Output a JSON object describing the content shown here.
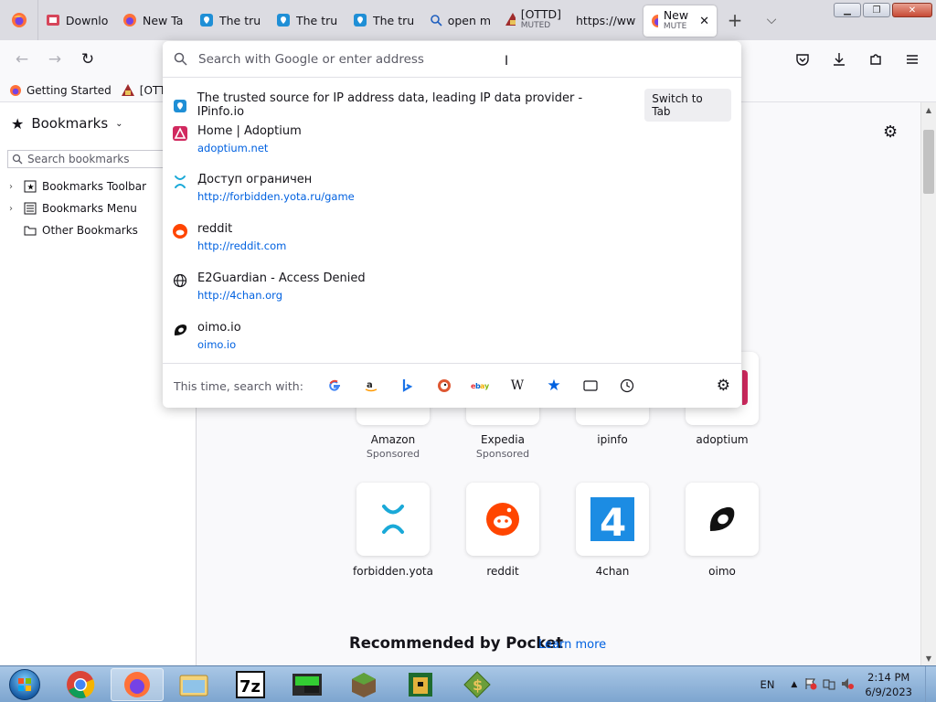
{
  "colors": {
    "accent": "#0061e0",
    "firefox_orange": "#ff7139",
    "ipinfo_blue": "#1f8fd6",
    "adoptium_pink": "#d1295f",
    "reddit_orange": "#ff4500",
    "taskbar": "#8fb3da"
  },
  "tabs": [
    {
      "title": "Downlo",
      "icon": "download-page-icon"
    },
    {
      "title": "New Ta",
      "icon": "firefox-icon"
    },
    {
      "title": "The tru",
      "icon": "ipinfo-icon"
    },
    {
      "title": "The tru",
      "icon": "ipinfo-icon"
    },
    {
      "title": "The tru",
      "icon": "ipinfo-icon"
    },
    {
      "title": "open m",
      "icon": "search-icon"
    },
    {
      "title": "[OTTD]",
      "subtitle": "MUTED",
      "icon": "ottd-icon"
    },
    {
      "title": "https://www",
      "icon": ""
    },
    {
      "title": "New",
      "subtitle": "MUTE",
      "icon": "firefox-icon",
      "active": true
    }
  ],
  "bookmarks_toolbar": [
    {
      "label": "Getting Started",
      "icon": "firefox-icon"
    },
    {
      "label": "[OTTD",
      "icon": "ottd-icon"
    }
  ],
  "sidebar": {
    "title": "Bookmarks",
    "search_placeholder": "Search bookmarks",
    "nodes": [
      {
        "label": "Bookmarks Toolbar",
        "expandable": true,
        "icon": "bookmark-toolbar-icon"
      },
      {
        "label": "Bookmarks Menu",
        "expandable": true,
        "icon": "bookmark-menu-icon"
      },
      {
        "label": "Other Bookmarks",
        "expandable": false,
        "icon": "folder-icon"
      }
    ]
  },
  "urlbar": {
    "placeholder": "Search with Google or enter address",
    "results": [
      {
        "title": "The trusted source for IP address data, leading IP data provider - IPinfo.io",
        "action": "Switch to Tab",
        "icon": "ipinfo-icon"
      },
      {
        "title": "Home | Adoptium",
        "url": "adoptium.net",
        "icon": "adoptium-icon"
      },
      {
        "title": "Доступ ограничен",
        "url": "http://forbidden.yota.ru/game",
        "icon": "yota-icon"
      },
      {
        "title": "reddit",
        "url": "http://reddit.com",
        "icon": "reddit-icon"
      },
      {
        "title": "E2Guardian - Access Denied",
        "url": "http://4chan.org",
        "icon": "globe-icon"
      },
      {
        "title": "oimo.io",
        "url": "oimo.io",
        "icon": "oimo-icon"
      }
    ],
    "one_off_label": "This time, search with:",
    "engines": [
      "google-icon",
      "amazon-icon",
      "bing-icon",
      "duckduckgo-icon",
      "ebay-icon",
      "wikipedia-icon",
      "bookmarks-star-icon",
      "tabs-icon",
      "history-icon"
    ]
  },
  "top_sites": [
    {
      "label": "Amazon",
      "sub": "Sponsored",
      "row": 1
    },
    {
      "label": "Expedia",
      "sub": "Sponsored",
      "row": 1
    },
    {
      "label": "ipinfo",
      "sub": "",
      "row": 1
    },
    {
      "label": "adoptium",
      "sub": "",
      "row": 1
    },
    {
      "label": "forbidden.yota",
      "sub": "",
      "row": 2,
      "icon": "yota-icon"
    },
    {
      "label": "reddit",
      "sub": "",
      "row": 2,
      "icon": "reddit-icon"
    },
    {
      "label": "4chan",
      "sub": "",
      "row": 2,
      "icon": "4chan-icon"
    },
    {
      "label": "oimo",
      "sub": "",
      "row": 2,
      "icon": "oimo-icon"
    }
  ],
  "pocket": {
    "title": "Recommended by Pocket",
    "link": "Learn more"
  },
  "taskbar": {
    "apps": [
      "chrome-icon",
      "firefox-icon",
      "explorer-icon",
      "7zip-icon",
      "terminal-icon",
      "minecraft-icon",
      "game-icon",
      "money-icon"
    ],
    "language": "EN",
    "time": "2:14 PM",
    "date": "6/9/2023"
  }
}
